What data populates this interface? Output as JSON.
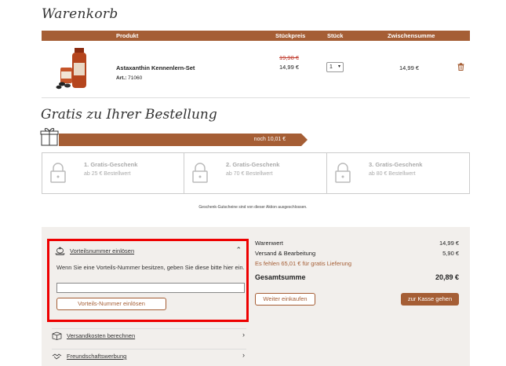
{
  "cart": {
    "title": "Warenkorb",
    "columns": [
      "Produkt",
      "Stückpreis",
      "Stück",
      "Zwischensumme"
    ],
    "item": {
      "name": "Astaxanthin Kennenlern-Set",
      "art_label": "Art.:",
      "art_number": "71060",
      "old_price": "19,98 €",
      "price": "14,99 €",
      "quantity": "1",
      "subtotal": "14,99 €"
    }
  },
  "gifts": {
    "title": "Gratis zu Ihrer Bestellung",
    "progress_label": "noch 10,01 €",
    "progress_fraction": 0.59,
    "tiers": [
      {
        "name": "1. Gratis-Geschenk",
        "min": "ab 25 € Bestellwert"
      },
      {
        "name": "2. Gratis-Geschenk",
        "min": "ab 70 € Bestellwert"
      },
      {
        "name": "3. Gratis-Geschenk",
        "min": "ab 80 € Bestellwert"
      }
    ],
    "note": "Geschenk-Gutscheine sind von dieser Aktion ausgeschlossen."
  },
  "voucher": {
    "title": "Vorteilsnummer einlösen",
    "description": "Wenn Sie eine Vorteils-Nummer besitzen, geben Sie diese bitte hier ein.",
    "input_value": "",
    "button": "Vorteils-Nummer einlösen"
  },
  "accordions": {
    "shipping": "Versandkosten berechnen",
    "referral": "Freundschaftswerbung"
  },
  "summary": {
    "goods_label": "Warenwert",
    "goods_value": "14,99 €",
    "shipping_label": "Versand & Bearbeitung",
    "shipping_value": "5,90 €",
    "free_shipping_hint": "Es fehlen 65,01 € für gratis Lieferung",
    "total_label": "Gesamtsumme",
    "total_value": "20,89 €",
    "continue_button": "Weiter einkaufen",
    "checkout_button": "zur Kasse gehen"
  },
  "colors": {
    "accent": "#a55e35",
    "highlight_border": "#e00000",
    "panel_bg": "#f2efec"
  }
}
